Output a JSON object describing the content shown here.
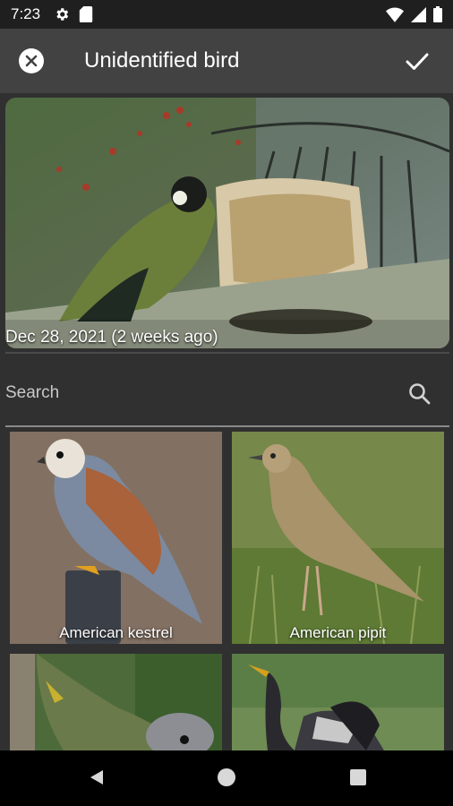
{
  "status": {
    "time": "7:23",
    "left_icons": [
      "gear-icon",
      "sd-card-icon"
    ],
    "right_icons": [
      "wifi-icon",
      "signal-icon",
      "battery-icon"
    ]
  },
  "appbar": {
    "title": "Unidentified bird",
    "close_icon": "close-icon",
    "confirm_icon": "check-icon"
  },
  "photo": {
    "date_label": "Dec 28, 2021 (2 weeks ago)"
  },
  "search": {
    "placeholder": "Search",
    "icon": "search-icon"
  },
  "birds": [
    {
      "name": "American kestrel"
    },
    {
      "name": "American pipit"
    },
    {
      "name": ""
    },
    {
      "name": ""
    }
  ],
  "colors": {
    "appbar": "#424242",
    "background": "#303030",
    "statusbar": "#1f1f1f"
  }
}
